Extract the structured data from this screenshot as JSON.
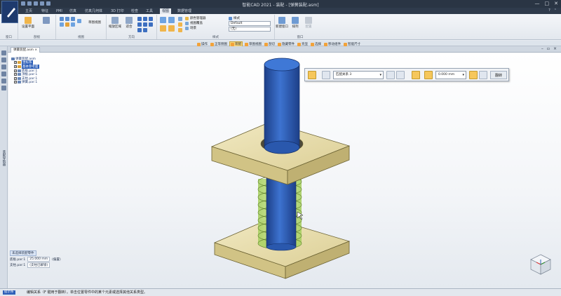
{
  "window": {
    "title": "智能CAD 2021 - 装配 - [弹簧装配.asm]",
    "controls": [
      "—",
      "□",
      "✕"
    ]
  },
  "ribbon_tabs": [
    {
      "label": "主页",
      "active": false
    },
    {
      "label": "特征",
      "active": false
    },
    {
      "label": "PMI",
      "active": false
    },
    {
      "label": "仿真",
      "active": false
    },
    {
      "label": "仿真几何体",
      "active": false
    },
    {
      "label": "3D 打印",
      "active": false
    },
    {
      "label": "检查",
      "active": false
    },
    {
      "label": "工具",
      "active": false
    },
    {
      "label": "视图",
      "active": true
    },
    {
      "label": "数据管理",
      "active": false
    }
  ],
  "ribbon": {
    "groups": [
      "窗口",
      "剖视",
      "视图",
      "方向",
      "样式",
      "窗口"
    ],
    "buttons": {
      "new_window": "新建窗口",
      "arrange": "排列",
      "settings_plane": "设置平面",
      "sketch_view": "草图视图",
      "zoom_area": "缩放区域",
      "pan": "适合",
      "config": "配置"
    },
    "style_rows": [
      "颜色管理器",
      "视图覆盖",
      "场景"
    ],
    "style_label": "样式",
    "style_select": "Default",
    "scene_select": "(无)"
  },
  "command_bar": [
    {
      "label": "操作",
      "active": false
    },
    {
      "label": "正等侧图",
      "active": false
    },
    {
      "label": "装配",
      "active": true
    },
    {
      "label": "草图视图",
      "active": false
    },
    {
      "label": "剖切",
      "active": false
    },
    {
      "label": "隐藏零件",
      "active": false
    },
    {
      "label": "亮显",
      "active": false
    },
    {
      "label": "选择",
      "active": false
    },
    {
      "label": "移动组件",
      "active": false
    },
    {
      "label": "智能尺寸",
      "active": false
    }
  ],
  "left_panel_label": "装配导航器",
  "document_tab": "弹簧装配.asm",
  "tree": [
    {
      "label": "弹簧装配.asm",
      "indent": 0,
      "selected": false
    },
    {
      "label": "坐标系",
      "indent": 1,
      "selected": true
    },
    {
      "label": "基本参考面",
      "indent": 1,
      "selected": true
    },
    {
      "label": "底板.par:1",
      "indent": 1,
      "selected": false
    },
    {
      "label": "顶板.par:1",
      "indent": 1,
      "selected": false
    },
    {
      "label": "支柱.par:1",
      "indent": 1,
      "selected": false
    },
    {
      "label": "弹簧.par:1",
      "indent": 1,
      "selected": false
    }
  ],
  "context_toolbar": {
    "relation_type": "匹配关系 3",
    "offset_value": "0.000 mm",
    "flip_label": "翻转"
  },
  "properties": {
    "title": "未选择装配零件",
    "rows": [
      {
        "part": "底板.par:1",
        "value": "25.000 mm",
        "extra": "(偏置)"
      },
      {
        "part": "支柱.par:1",
        "value": "(支柱已解锁)",
        "extra": ""
      }
    ]
  },
  "status_bar": {
    "label": "提示条",
    "message": "编辑关系（F 键用于翻转）。单击位置零件中的某个元素或选择其他关系类型。"
  },
  "colors": {
    "plate_face": "#e6dba8",
    "plate_side": "#cbbd83",
    "rod_blue": "#2e5fb8",
    "spring_green": "#b7d86c",
    "ribbon_bg": "#eef1f5",
    "title_bg": "#2a3544",
    "accent": "#f6c75b"
  }
}
